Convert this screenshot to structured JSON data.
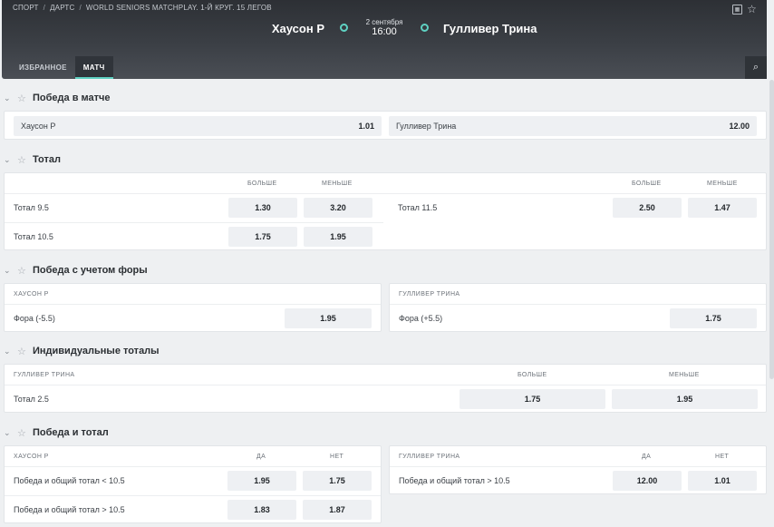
{
  "breadcrumb": [
    "СПОРТ",
    "ДАРТС",
    "WORLD SENIORS MATCHPLAY. 1-Й КРУГ. 15 ЛЕГОВ"
  ],
  "match": {
    "home": "Хаусон Р",
    "away": "Гулливер Трина",
    "date": "2 сентября",
    "time": "16:00"
  },
  "tabs": [
    "ИЗБРАННОЕ",
    "МАТЧ"
  ],
  "sections": {
    "winner": {
      "title": "Победа в матче",
      "options": [
        {
          "name": "Хаусон Р",
          "odd": "1.01"
        },
        {
          "name": "Гулливер Трина",
          "odd": "12.00"
        }
      ]
    },
    "total": {
      "title": "Тотал",
      "col_over": "БОЛЬШЕ",
      "col_under": "МЕНЬШЕ",
      "left": [
        {
          "name": "Тотал 9.5",
          "over": "1.30",
          "under": "3.20"
        },
        {
          "name": "Тотал 10.5",
          "over": "1.75",
          "under": "1.95"
        }
      ],
      "right": [
        {
          "name": "Тотал 11.5",
          "over": "2.50",
          "under": "1.47"
        }
      ]
    },
    "handicap": {
      "title": "Победа с учетом форы",
      "left": {
        "header": "ХАУСОН Р",
        "name": "Фора (-5.5)",
        "odd": "1.95"
      },
      "right": {
        "header": "ГУЛЛИВЕР ТРИНА",
        "name": "Фора (+5.5)",
        "odd": "1.75"
      }
    },
    "individual": {
      "title": "Индивидуальные тоталы",
      "header": "ГУЛЛИВЕР ТРИНА",
      "col_over": "БОЛЬШЕ",
      "col_under": "МЕНЬШЕ",
      "rows": [
        {
          "name": "Тотал 2.5",
          "over": "1.75",
          "under": "1.95"
        }
      ]
    },
    "win_total": {
      "title": "Победа и тотал",
      "col_yes": "ДА",
      "col_no": "НЕТ",
      "left": {
        "header": "ХАУСОН Р",
        "rows": [
          {
            "name": "Победа и общий тотал < 10.5",
            "yes": "1.95",
            "no": "1.75"
          },
          {
            "name": "Победа и общий тотал > 10.5",
            "yes": "1.83",
            "no": "1.87"
          }
        ]
      },
      "right": {
        "header": "ГУЛЛИВЕР ТРИНА",
        "rows": [
          {
            "name": "Победа и общий тотал > 10.5",
            "yes": "12.00",
            "no": "1.01"
          }
        ]
      }
    }
  },
  "icons": {
    "chevron": "chevron-down-icon",
    "favorite": "star-icon",
    "search": "search-icon",
    "stats": "stats-icon"
  },
  "colors": {
    "accent": "#5fd1c2",
    "header_bg": "#3b3f45",
    "odd_bg": "#eef0f3"
  }
}
